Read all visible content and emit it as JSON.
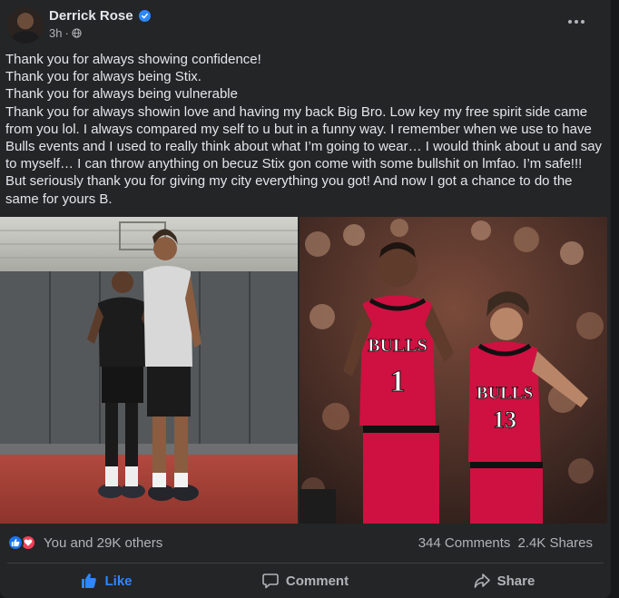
{
  "post": {
    "author": "Derrick Rose",
    "time": "3h",
    "time_separator": "·",
    "lines": [
      "Thank you for always showing confidence!",
      "Thank you for always being Stix.",
      "Thank you for always being vulnerable",
      "Thank you for always showin love and having my back Big Bro. Low key my free spirit side came from you lol. I always compared my self to u but in a funny way. I remember when we use to have Bulls events and I used to really think about what I’m going to wear… I would think about u and say to myself… I can throw anything on becuz Stix gon come with some bullshit on lmfao. I’m safe!!! But seriously thank you for giving my city everything you got! And now I got a chance to do the same for yours B."
    ],
    "photos": {
      "left": {
        "icon": "photo-two-men-gym"
      },
      "right": {
        "icon": "photo-bulls-players",
        "jersey_text_1": "BULLS",
        "jersey_number_1": "1",
        "jersey_text_2": "BULLS",
        "jersey_number_2": "13"
      }
    }
  },
  "engagement": {
    "reactions_text": "You and 29K others",
    "comments": "344 Comments",
    "shares": "2.4K Shares"
  },
  "actions": {
    "like": "Like",
    "comment": "Comment",
    "share": "Share"
  },
  "colors": {
    "card": "#242526",
    "text": "#e4e6eb",
    "secondary": "#b0b3b8",
    "accent": "#2d88ff",
    "bulls_red": "#ce1141"
  }
}
